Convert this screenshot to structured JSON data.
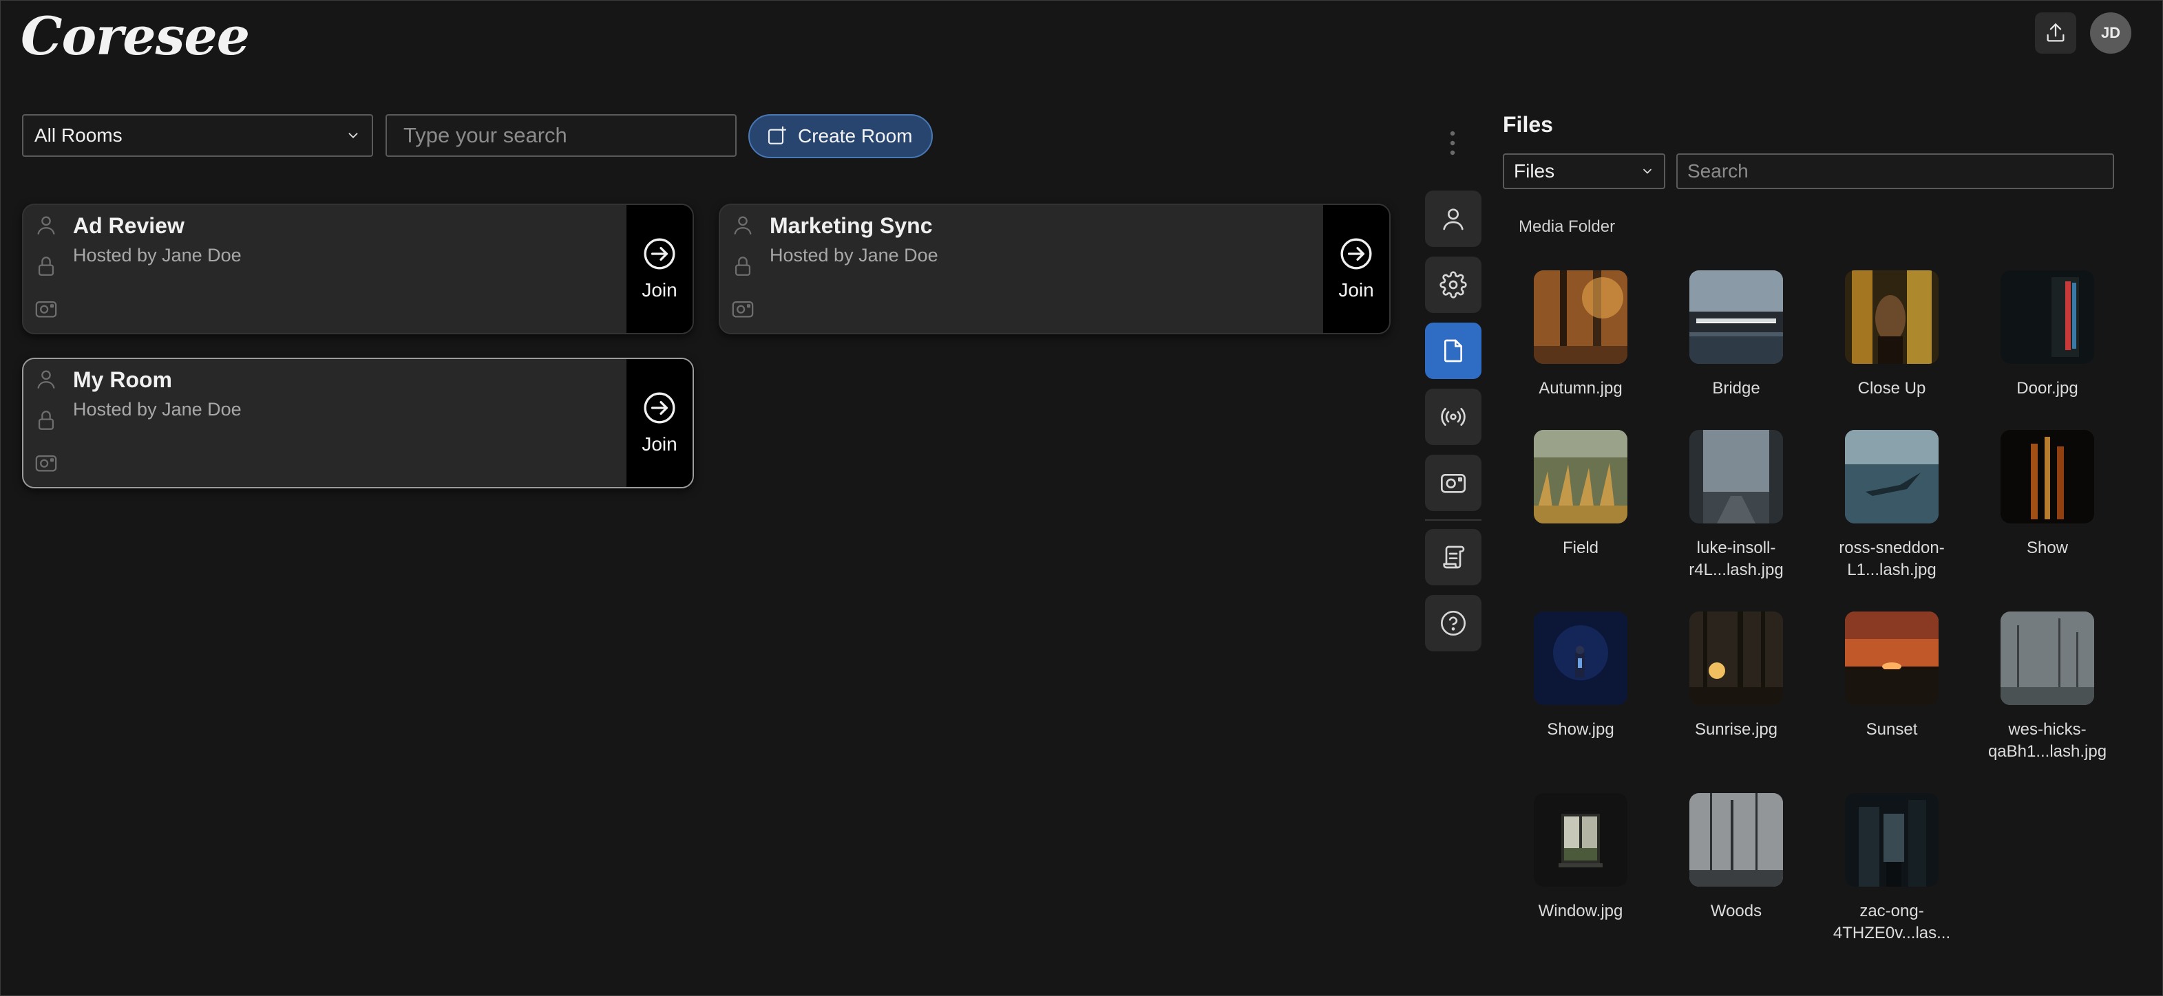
{
  "app": {
    "logo": "Coresee",
    "user_initials": "JD"
  },
  "toolbar": {
    "room_filter": "All Rooms",
    "search_placeholder": "Type your search",
    "create_label": "Create Room"
  },
  "rooms": [
    {
      "title": "Ad Review",
      "host": "Hosted by Jane Doe",
      "join_label": "Join",
      "selected": false
    },
    {
      "title": "Marketing Sync",
      "host": "Hosted by Jane Doe",
      "join_label": "Join",
      "selected": false
    },
    {
      "title": "My Room",
      "host": "Hosted by Jane Doe",
      "join_label": "Join",
      "selected": true
    }
  ],
  "rail": {
    "items": [
      {
        "name": "user-icon",
        "active": false
      },
      {
        "name": "gear-icon",
        "active": false
      },
      {
        "name": "file-icon",
        "active": true
      },
      {
        "name": "broadcast-icon",
        "active": false
      },
      {
        "name": "camera-icon",
        "active": false
      },
      {
        "name": "scroll-icon",
        "active": false
      },
      {
        "name": "help-icon",
        "active": false
      }
    ]
  },
  "files": {
    "title": "Files",
    "filter": "Files",
    "search_placeholder": "Search",
    "folder_label": "Media Folder",
    "items": [
      {
        "name": "Autumn.jpg",
        "name2": ""
      },
      {
        "name": "Bridge",
        "name2": ""
      },
      {
        "name": "Close Up",
        "name2": ""
      },
      {
        "name": "Door.jpg",
        "name2": ""
      },
      {
        "name": "Field",
        "name2": ""
      },
      {
        "name": "luke-insoll-",
        "name2": "r4L...lash.jpg"
      },
      {
        "name": "ross-sneddon-",
        "name2": "L1...lash.jpg"
      },
      {
        "name": "Show",
        "name2": ""
      },
      {
        "name": "Show.jpg",
        "name2": ""
      },
      {
        "name": "Sunrise.jpg",
        "name2": ""
      },
      {
        "name": "Sunset",
        "name2": ""
      },
      {
        "name": "wes-hicks-",
        "name2": "qaBh1...lash.jpg"
      },
      {
        "name": "Window.jpg",
        "name2": ""
      },
      {
        "name": "Woods",
        "name2": ""
      },
      {
        "name": "zac-ong-",
        "name2": "4THZE0v...las..."
      }
    ]
  },
  "colors": {
    "accent": "#2f6dc4",
    "create_bg": "#27456f",
    "background": "#161616"
  }
}
